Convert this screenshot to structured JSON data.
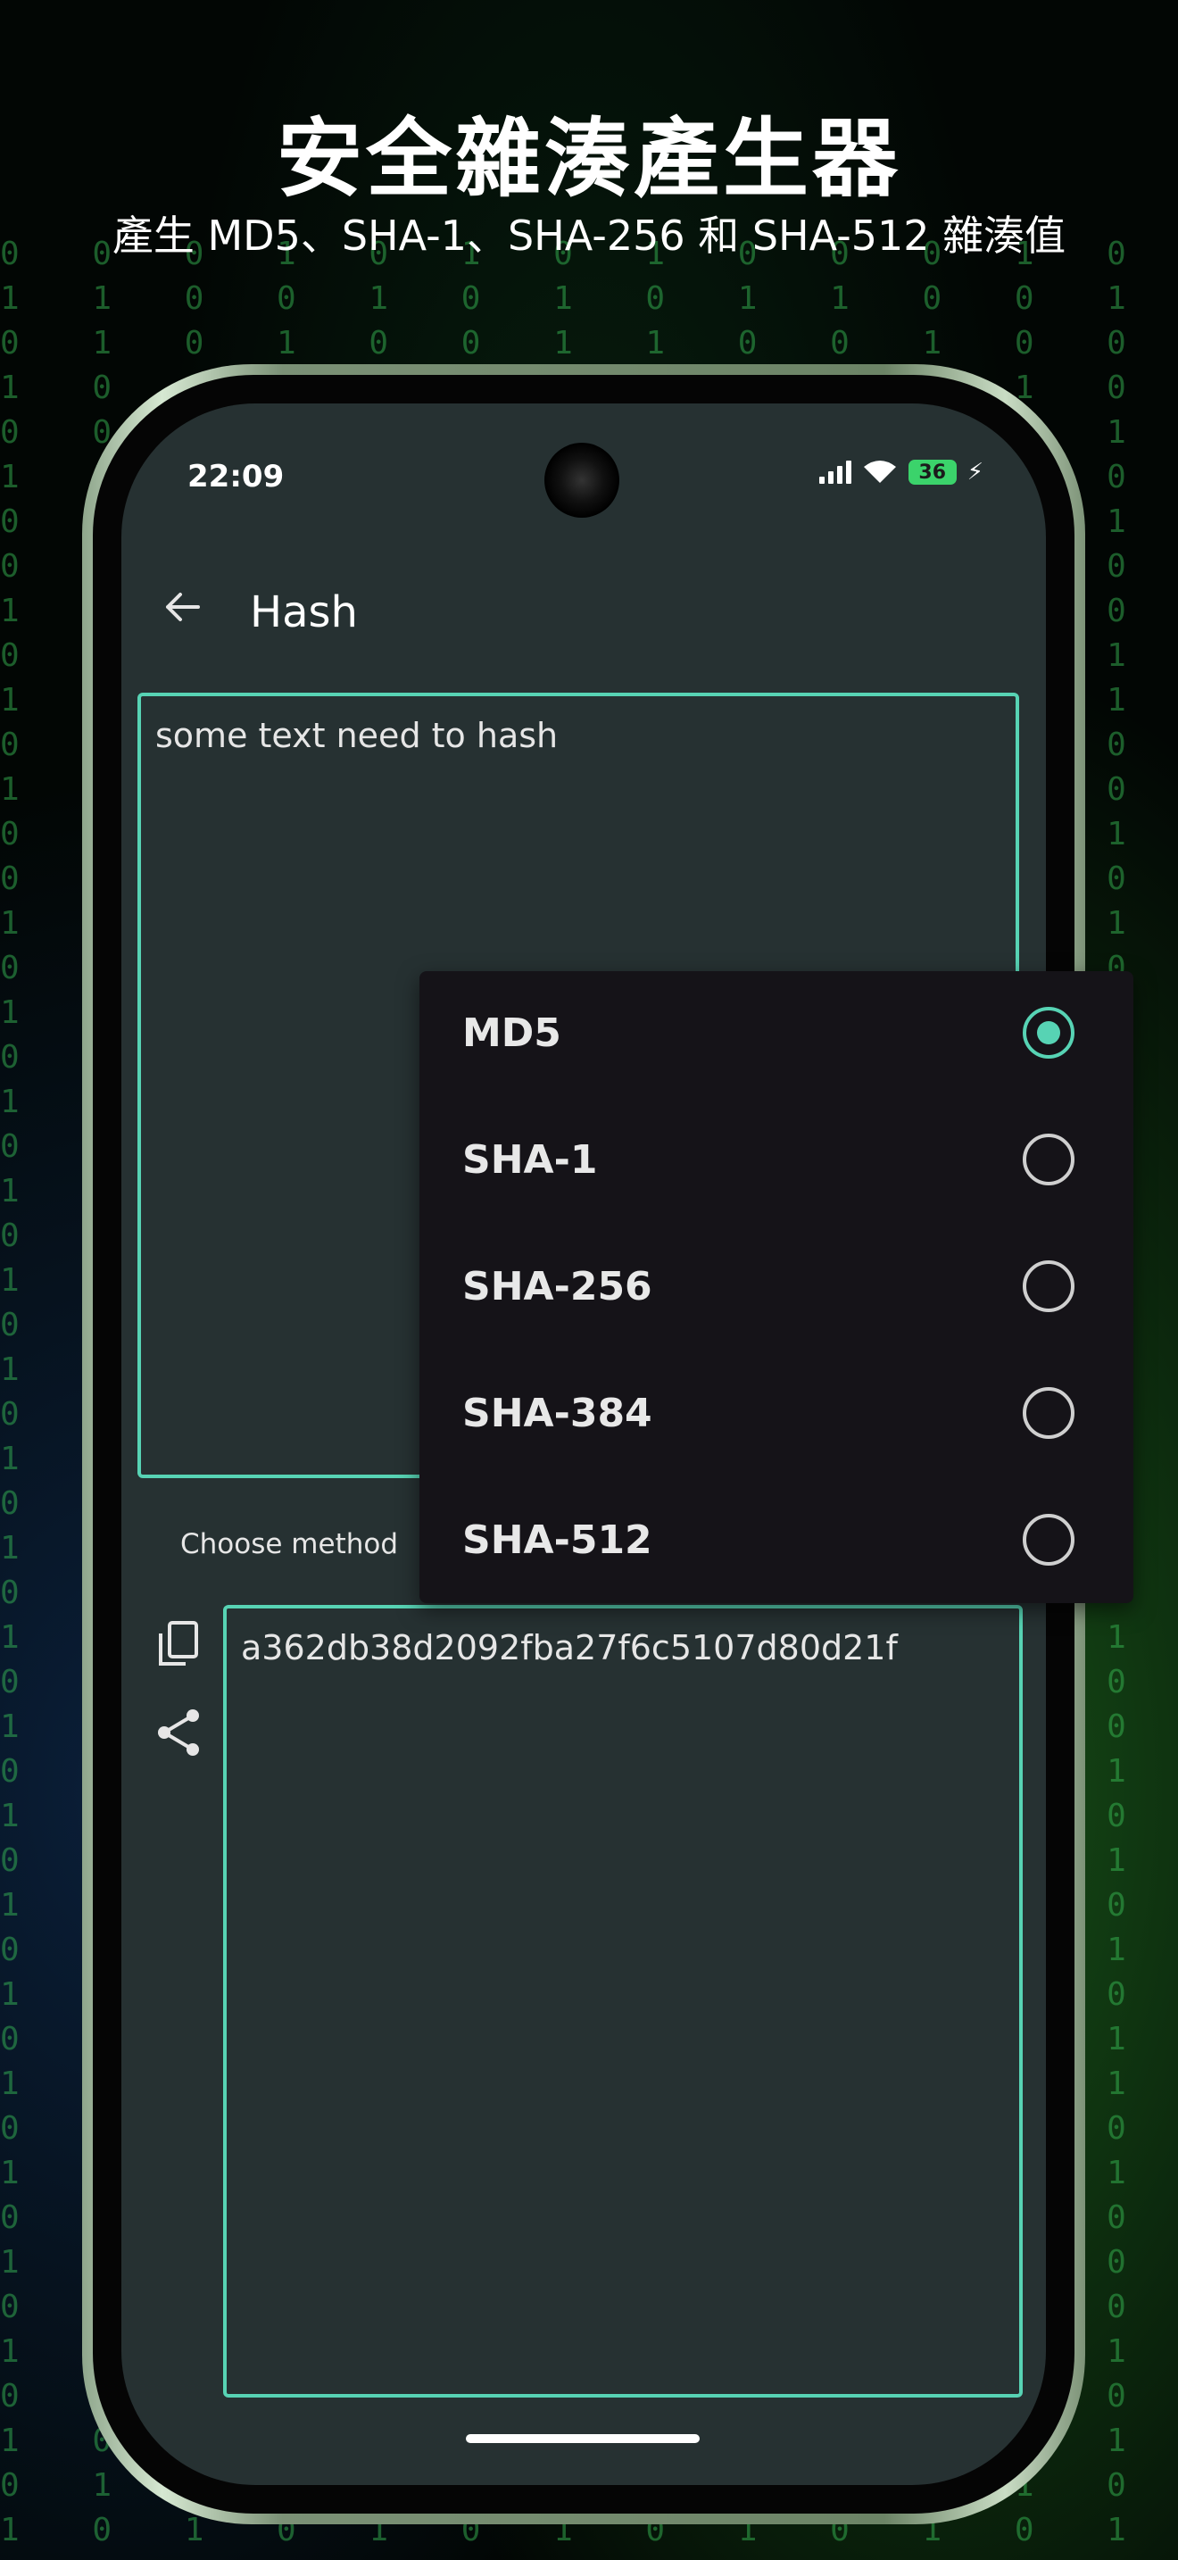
{
  "promo": {
    "headline": "安全雜湊產生器",
    "subline": "產生 MD5、SHA-1、SHA-256 和 SHA-512 雜湊值"
  },
  "status_bar": {
    "time": "22:09",
    "battery": "36"
  },
  "app_bar": {
    "title": "Hash"
  },
  "input": {
    "value": "some text need to hash"
  },
  "method": {
    "label": "Choose method",
    "options": [
      "MD5",
      "SHA-1",
      "SHA-256",
      "SHA-384",
      "SHA-512"
    ],
    "selected": "MD5"
  },
  "output": {
    "value": "a362db38d2092fba27f6c5107d80d21f"
  },
  "colors": {
    "accent": "#57d3b4",
    "screen_bg": "#263132",
    "menu_bg": "#151318"
  }
}
